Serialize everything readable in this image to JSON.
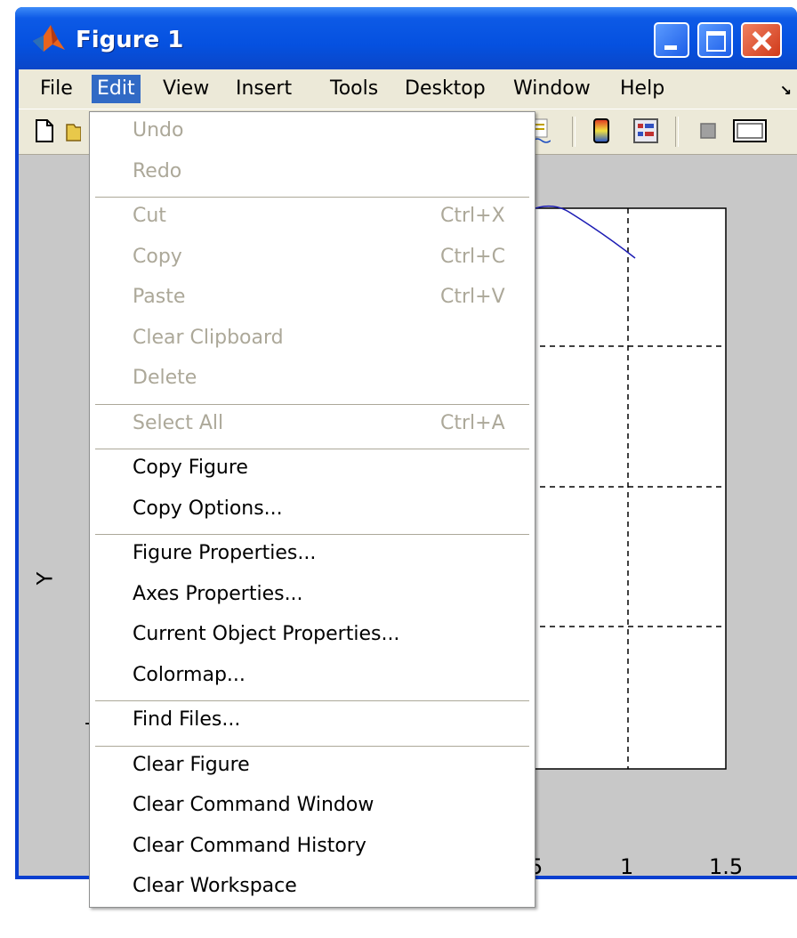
{
  "window": {
    "title": "Figure 1",
    "accent_color": "#0551e0",
    "controls": [
      "minimize-icon",
      "maximize-icon",
      "close-icon"
    ]
  },
  "menubar": {
    "items": [
      {
        "label": "File",
        "mnemonic": "F"
      },
      {
        "label": "Edit",
        "mnemonic": "E",
        "active": true
      },
      {
        "label": "View",
        "mnemonic": "V"
      },
      {
        "label": "Insert",
        "mnemonic": "I"
      },
      {
        "label": "Tools",
        "mnemonic": "T"
      },
      {
        "label": "Desktop",
        "mnemonic": "D"
      },
      {
        "label": "Window",
        "mnemonic": "W"
      },
      {
        "label": "Help",
        "mnemonic": "H"
      }
    ],
    "overflow_glyph": "↘"
  },
  "toolbar": {
    "icons": [
      "new-figure-icon",
      "open-file-icon",
      "insert-legend-icon",
      "insert-colorbar-icon",
      "plot-tools-icon",
      "hide-plot-tools-icon",
      "show-plot-tools-icon"
    ]
  },
  "plot": {
    "ylabel": "Y",
    "xticks": [
      "5",
      "1",
      "1.5"
    ],
    "ytick_fragment": "-"
  },
  "edit_menu": {
    "groups": [
      [
        {
          "label": "Undo",
          "mnemonic": "U",
          "enabled": false,
          "shortcut": ""
        },
        {
          "label": "Redo",
          "mnemonic": "R",
          "enabled": false,
          "shortcut": ""
        }
      ],
      [
        {
          "label": "Cut",
          "mnemonic": "t",
          "enabled": false,
          "shortcut": "Ctrl+X"
        },
        {
          "label": "Copy",
          "mnemonic": "C",
          "enabled": false,
          "shortcut": "Ctrl+C"
        },
        {
          "label": "Paste",
          "mnemonic": "P",
          "enabled": false,
          "shortcut": "Ctrl+V"
        },
        {
          "label": "Clear Clipboard",
          "mnemonic": "r",
          "enabled": false,
          "shortcut": ""
        },
        {
          "label": "Delete",
          "mnemonic": "",
          "enabled": false,
          "shortcut": ""
        }
      ],
      [
        {
          "label": "Select All",
          "mnemonic": "S",
          "enabled": false,
          "shortcut": "Ctrl+A"
        }
      ],
      [
        {
          "label": "Copy Figure",
          "mnemonic": "F",
          "enabled": true,
          "shortcut": ""
        },
        {
          "label": "Copy Options...",
          "mnemonic": "O",
          "enabled": true,
          "shortcut": ""
        }
      ],
      [
        {
          "label": "Figure Properties...",
          "mnemonic": "i",
          "enabled": true,
          "shortcut": ""
        },
        {
          "label": "Axes Properties...",
          "mnemonic": "A",
          "enabled": true,
          "shortcut": ""
        },
        {
          "label": "Current Object Properties...",
          "mnemonic": "u",
          "enabled": true,
          "shortcut": ""
        },
        {
          "label": "Colormap...",
          "mnemonic": "m",
          "enabled": true,
          "shortcut": ""
        }
      ],
      [
        {
          "label": "Find Files...",
          "mnemonic": "F",
          "enabled": true,
          "shortcut": ""
        }
      ],
      [
        {
          "label": "Clear Figure",
          "mnemonic": "F",
          "enabled": true,
          "shortcut": ""
        },
        {
          "label": "Clear Command Window",
          "mnemonic": "C",
          "enabled": true,
          "shortcut": ""
        },
        {
          "label": "Clear Command History",
          "mnemonic": "C",
          "enabled": true,
          "shortcut": ""
        },
        {
          "label": "Clear Workspace",
          "mnemonic": "W",
          "enabled": true,
          "shortcut": ""
        }
      ]
    ]
  }
}
